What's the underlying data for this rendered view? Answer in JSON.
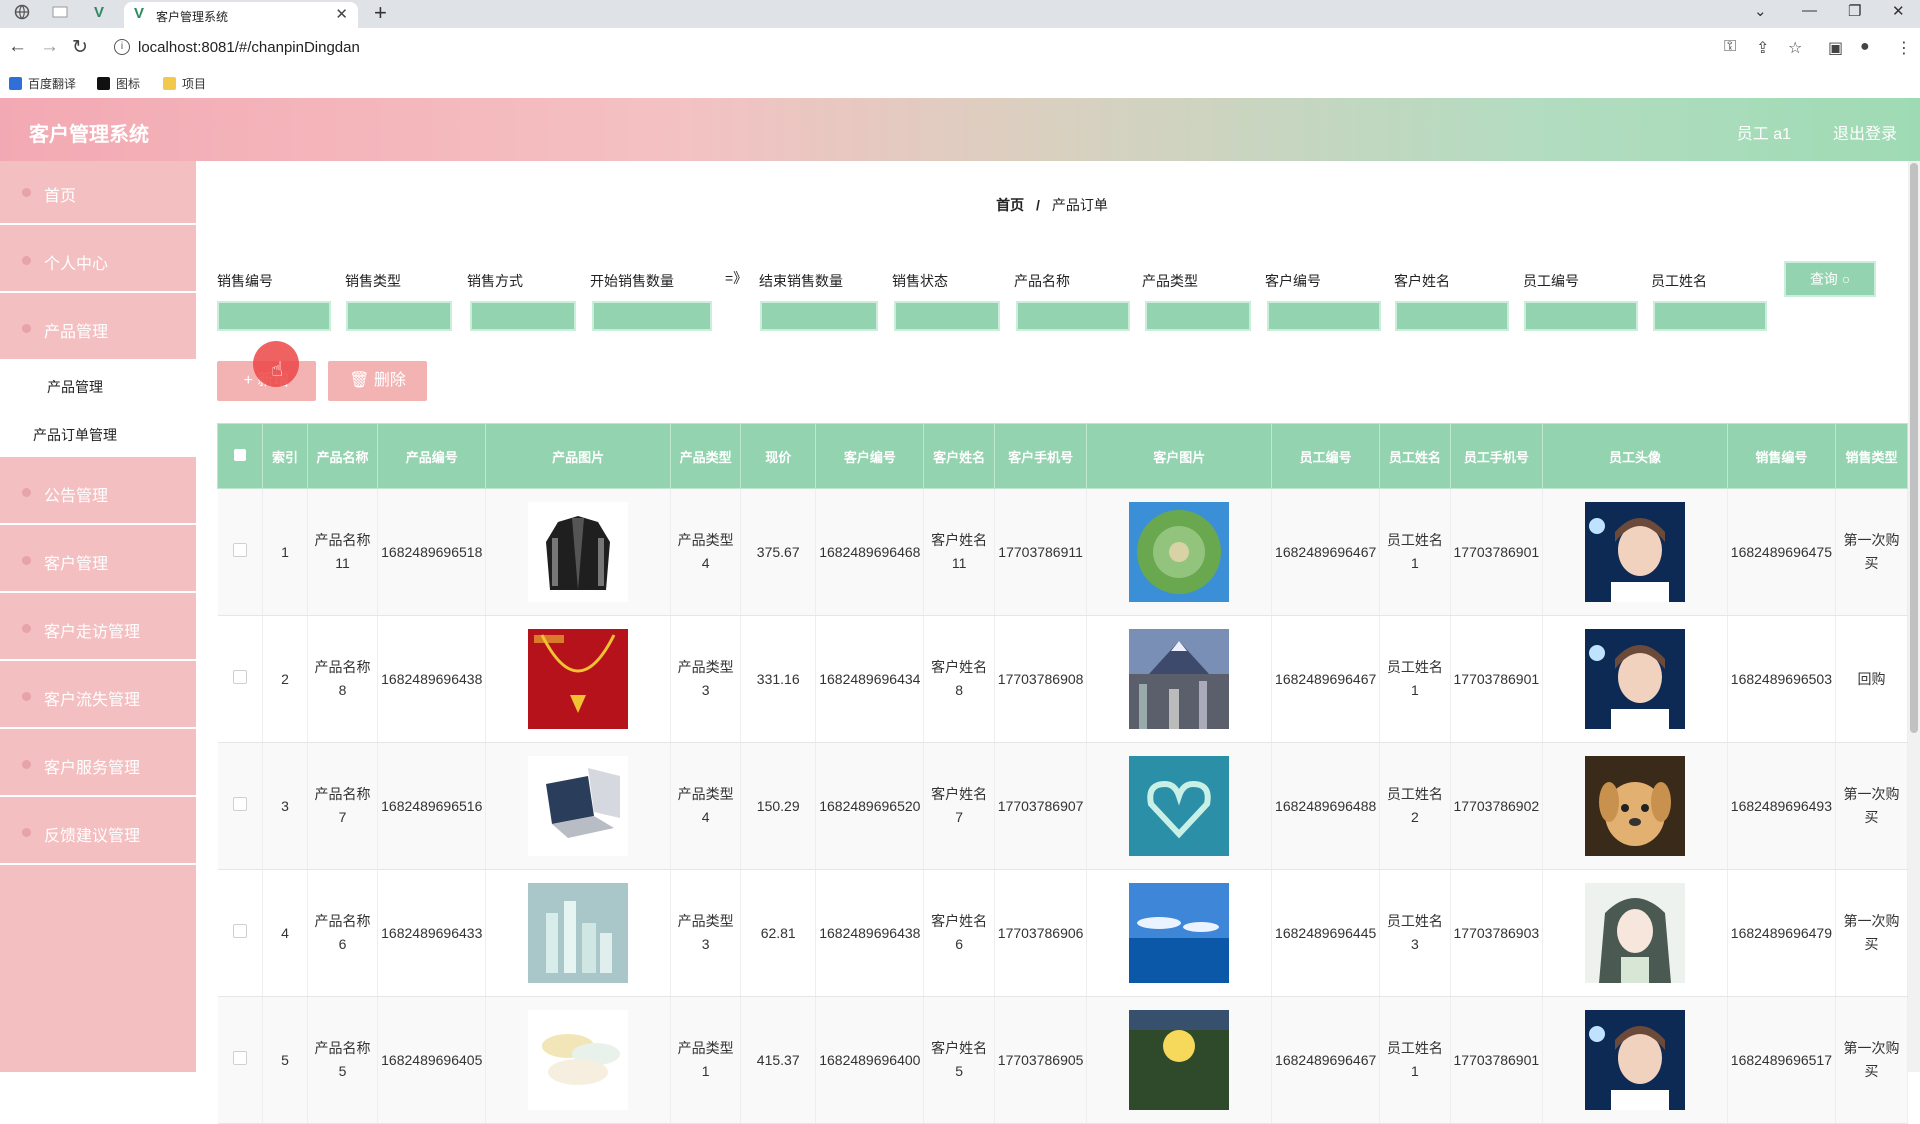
{
  "browser": {
    "tab_title": "客户管理系统",
    "url": "localhost:8081/#/chanpinDingdan",
    "bookmarks": [
      "百度翻译",
      "图标",
      "项目"
    ]
  },
  "header": {
    "title": "客户管理系统",
    "user": "员工 a1",
    "logout": "退出登录"
  },
  "sidebar": {
    "items": [
      "首页",
      "个人中心",
      "产品管理",
      "公告管理",
      "客户管理",
      "客户走访管理",
      "客户流失管理",
      "客户服务管理",
      "反馈建议管理"
    ],
    "submenu": [
      "产品管理",
      "产品订单管理"
    ]
  },
  "breadcrumb": {
    "home": "首页",
    "separator": "/",
    "current": "产品订单"
  },
  "filters": {
    "labels": [
      "销售编号",
      "销售类型",
      "销售方式",
      "开始销售数量",
      "=》",
      "结束销售数量",
      "销售状态",
      "产品名称",
      "产品类型",
      "客户编号",
      "客户姓名",
      "员工编号",
      "员工姓名"
    ],
    "query_button": "查询 ○"
  },
  "actions": {
    "add": "+ 新增",
    "delete": "删除"
  },
  "table": {
    "headers": [
      "索引",
      "产品名称",
      "产品编号",
      "产品图片",
      "产品类型",
      "现价",
      "客户编号",
      "客户姓名",
      "客户手机号",
      "客户图片",
      "员工编号",
      "员工姓名",
      "员工手机号",
      "员工头像",
      "销售编号",
      "销售类型"
    ],
    "rows": [
      {
        "index": "1",
        "product_name": "产品名称11",
        "product_no": "1682489696518",
        "product_type": "产品类型4",
        "price": "375.67",
        "customer_no": "1682489696468",
        "customer_name": "客户姓名11",
        "customer_phone": "17703786911",
        "staff_no": "1682489696467",
        "staff_name": "员工姓名1",
        "staff_phone": "17703786901",
        "sale_no": "1682489696475",
        "sale_type": "第一次购买"
      },
      {
        "index": "2",
        "product_name": "产品名称8",
        "product_no": "1682489696438",
        "product_type": "产品类型3",
        "price": "331.16",
        "customer_no": "1682489696434",
        "customer_name": "客户姓名8",
        "customer_phone": "17703786908",
        "staff_no": "1682489696467",
        "staff_name": "员工姓名1",
        "staff_phone": "17703786901",
        "sale_no": "1682489696503",
        "sale_type": "回购"
      },
      {
        "index": "3",
        "product_name": "产品名称7",
        "product_no": "1682489696516",
        "product_type": "产品类型4",
        "price": "150.29",
        "customer_no": "1682489696520",
        "customer_name": "客户姓名7",
        "customer_phone": "17703786907",
        "staff_no": "1682489696488",
        "staff_name": "员工姓名2",
        "staff_phone": "17703786902",
        "sale_no": "1682489696493",
        "sale_type": "第一次购买"
      },
      {
        "index": "4",
        "product_name": "产品名称6",
        "product_no": "1682489696433",
        "product_type": "产品类型3",
        "price": "62.81",
        "customer_no": "1682489696438",
        "customer_name": "客户姓名6",
        "customer_phone": "17703786906",
        "staff_no": "1682489696445",
        "staff_name": "员工姓名3",
        "staff_phone": "17703786903",
        "sale_no": "1682489696479",
        "sale_type": "第一次购买"
      },
      {
        "index": "5",
        "product_name": "产品名称5",
        "product_no": "1682489696405",
        "product_type": "产品类型1",
        "price": "415.37",
        "customer_no": "1682489696400",
        "customer_name": "客户姓名5",
        "customer_phone": "17703786905",
        "staff_no": "1682489696467",
        "staff_name": "员工姓名1",
        "staff_phone": "17703786901",
        "sale_no": "1682489696517",
        "sale_type": "第一次购买"
      }
    ]
  },
  "colors": {
    "accent_green": "#94d3b0",
    "sidebar_pink": "#f4bfc1",
    "button_pink": "#f4b3b3"
  }
}
